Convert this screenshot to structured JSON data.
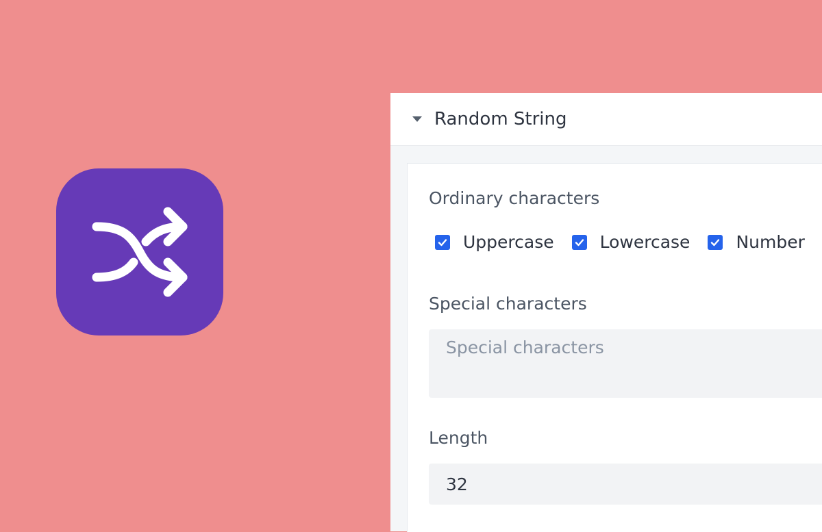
{
  "app": {
    "icon": "shuffle-icon",
    "icon_color": "#663ab7",
    "background_color": "#ef8e8e"
  },
  "panel": {
    "title": "Random String",
    "ordinary": {
      "label": "Ordinary characters",
      "options": [
        {
          "label": "Uppercase",
          "checked": true
        },
        {
          "label": "Lowercase",
          "checked": true
        },
        {
          "label": "Number",
          "checked": true
        }
      ]
    },
    "special": {
      "label": "Special characters",
      "placeholder": "Special characters",
      "value": ""
    },
    "length": {
      "label": "Length",
      "value": "32"
    },
    "accent_color": "#2563eb"
  }
}
